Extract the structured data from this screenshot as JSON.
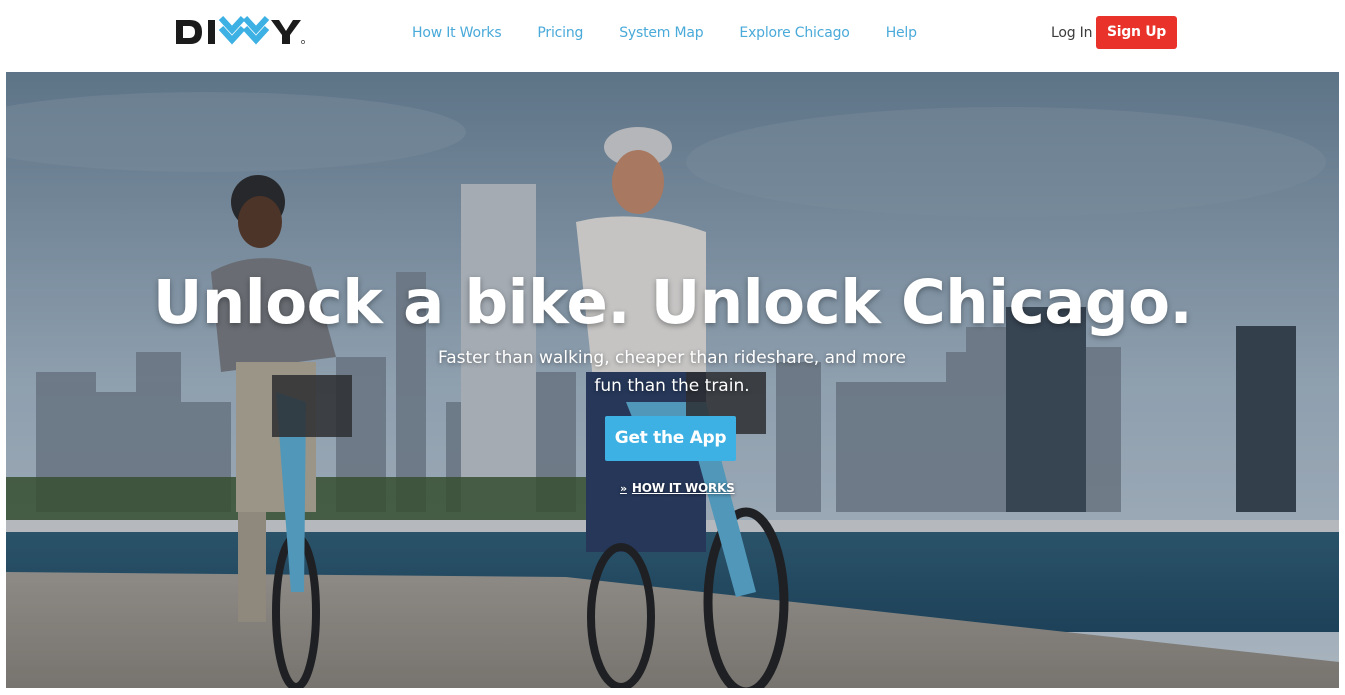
{
  "header": {
    "logo_text": "DIVVY",
    "nav": [
      {
        "label": "How It Works"
      },
      {
        "label": "Pricing"
      },
      {
        "label": "System Map"
      },
      {
        "label": "Explore Chicago"
      },
      {
        "label": "Help"
      }
    ],
    "login_label": "Log In",
    "signup_label": "Sign Up"
  },
  "hero": {
    "headline": "Unlock a bike. Unlock Chicago.",
    "subline": "Faster than walking, cheaper than rideshare, and more fun than the train.",
    "cta_label": "Get the App",
    "secondary_link": "HOW IT WORKS",
    "secondary_link_icon": "double-chevron-right-icon"
  },
  "colors": {
    "brand_blue": "#3db1e3",
    "nav_link": "#4aaad9",
    "signup_red": "#e8322a",
    "logo_dark": "#1b1b1b"
  }
}
